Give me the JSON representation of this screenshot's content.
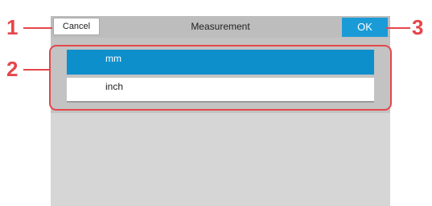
{
  "dialog": {
    "title": "Measurement",
    "cancel_label": "Cancel",
    "ok_label": "OK"
  },
  "options": [
    {
      "label": "mm",
      "selected": true
    },
    {
      "label": "inch",
      "selected": false
    }
  ],
  "callouts": [
    "1",
    "2",
    "3"
  ],
  "colors": {
    "accent": "#1a9bd7",
    "selected_row": "#0d8fcc",
    "callout": "#e5464b",
    "header": "#bdbdbd",
    "panel": "#d6d6d6"
  }
}
